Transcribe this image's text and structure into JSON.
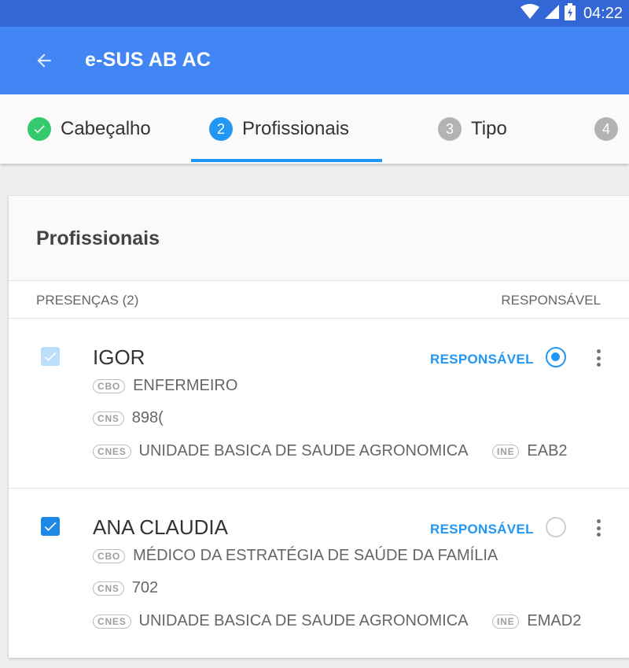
{
  "status_bar": {
    "time": "04:22",
    "icons": [
      "wifi-icon",
      "signal-icon",
      "battery-icon"
    ]
  },
  "app_bar": {
    "title": "e-SUS AB AC",
    "back_icon": "arrow-back-icon"
  },
  "steps": [
    {
      "number": "",
      "label": "Cabeçalho",
      "state": "done"
    },
    {
      "number": "2",
      "label": "Profissionais",
      "state": "active"
    },
    {
      "number": "3",
      "label": "Tipo",
      "state": "todo"
    },
    {
      "number": "4",
      "label": "",
      "state": "todo"
    }
  ],
  "card": {
    "title": "Profissionais",
    "list_header": {
      "left": "PRESENÇAS (2)",
      "right": "RESPONSÁVEL"
    },
    "professionals": [
      {
        "name": "IGOR",
        "checked": true,
        "checkbox_disabled": true,
        "responsavel_label": "RESPONSÁVEL",
        "responsavel_selected": true,
        "cbo_tag": "CBO",
        "cbo": "ENFERMEIRO",
        "cns_tag": "CNS",
        "cns": "898(",
        "cnes_tag": "CNES",
        "cnes": "UNIDADE BASICA DE SAUDE AGRONOMICA",
        "ine_tag": "INE",
        "ine": "EAB2"
      },
      {
        "name": "ANA CLAUDIA",
        "checked": true,
        "checkbox_disabled": false,
        "responsavel_label": "RESPONSÁVEL",
        "responsavel_selected": false,
        "cbo_tag": "CBO",
        "cbo": "MÉDICO DA ESTRATÉGIA DE SAÚDE DA FAMÍLIA",
        "cns_tag": "CNS",
        "cns": "702",
        "cnes_tag": "CNES",
        "cnes": "UNIDADE BASICA DE SAUDE AGRONOMICA",
        "ine_tag": "INE",
        "ine": "EMAD2"
      }
    ]
  },
  "colors": {
    "status_bar": "#3367d6",
    "app_bar": "#4285f4",
    "accent": "#2196f3",
    "done": "#34c96c",
    "pending": "#b3b3b3"
  }
}
